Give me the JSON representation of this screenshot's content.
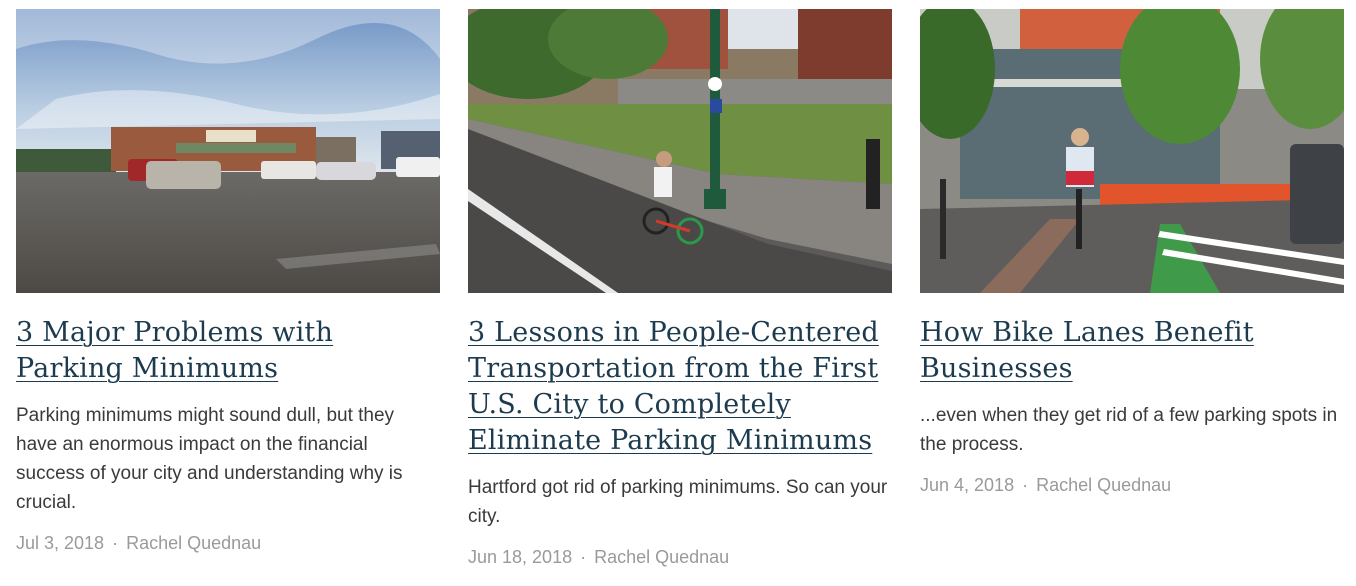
{
  "posts": [
    {
      "title": "3 Major Problems with Parking Minimums",
      "excerpt": "Parking minimums might sound dull, but they have an enormous impact on the financial success of your city and understanding why is crucial.",
      "date": "Jul 3, 2018",
      "author": "Rachel Quednau",
      "image_subject": "parking-lot-photo"
    },
    {
      "title": "3 Lessons in People-Centered Transportation from the First U.S. City to Completely Eliminate Parking Minimums",
      "excerpt": "Hartford got rid of parking minimums. So can your city.",
      "date": "Jun 18, 2018",
      "author": "Rachel Quednau",
      "image_subject": "cyclist-street-photo"
    },
    {
      "title": "How Bike Lanes Benefit Businesses",
      "excerpt": "...even when they get rid of a few parking spots in the process.",
      "date": "Jun 4, 2018",
      "author": "Rachel Quednau",
      "image_subject": "bike-lane-photo"
    }
  ],
  "meta_separator": "·",
  "colors": {
    "title": "#1d3b4f",
    "excerpt": "#3a3a3a",
    "meta": "#9a9a9a"
  }
}
